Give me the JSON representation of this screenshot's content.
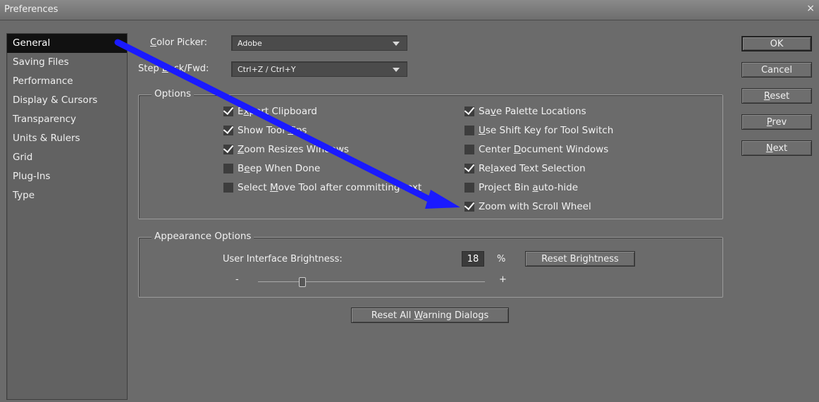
{
  "window": {
    "title": "Preferences",
    "close_glyph": "×"
  },
  "sidebar": {
    "items": [
      {
        "label": "General",
        "active": true
      },
      {
        "label": "Saving Files"
      },
      {
        "label": "Performance"
      },
      {
        "label": "Display & Cursors"
      },
      {
        "label": "Transparency"
      },
      {
        "label": "Units & Rulers"
      },
      {
        "label": "Grid"
      },
      {
        "label": "Plug-Ins"
      },
      {
        "label": "Type"
      }
    ]
  },
  "general": {
    "color_picker": {
      "label_underlined": "C",
      "label_rest": "olor Picker:",
      "value": "Adobe"
    },
    "step": {
      "label_prefix": "Step ",
      "label_underlined": "B",
      "label_rest": "ack/Fwd:",
      "value": "Ctrl+Z / Ctrl+Y"
    },
    "options_legend": "Options",
    "options_left": [
      {
        "pre": "E",
        "u": "x",
        "post": "port Clipboard",
        "checked": true
      },
      {
        "pre": "Show Tool ",
        "u": "T",
        "post": "ips",
        "checked": true
      },
      {
        "pre": "",
        "u": "Z",
        "post": "oom Resizes Windows",
        "checked": true
      },
      {
        "pre": "B",
        "u": "e",
        "post": "ep When Done",
        "checked": false
      },
      {
        "pre": "Select ",
        "u": "M",
        "post": "ove Tool after committing text",
        "checked": false
      }
    ],
    "options_right": [
      {
        "pre": "Sa",
        "u": "v",
        "post": "e Palette Locations",
        "checked": true
      },
      {
        "pre": "",
        "u": "U",
        "post": "se Shift Key for Tool Switch",
        "checked": false
      },
      {
        "pre": "Center ",
        "u": "D",
        "post": "ocument Windows",
        "checked": false
      },
      {
        "pre": "Re",
        "u": "l",
        "post": "axed Text Selection",
        "checked": true
      },
      {
        "pre": "Project Bin ",
        "u": "a",
        "post": "uto-hide",
        "checked": false
      },
      {
        "pre": "",
        "u": "",
        "post": "Zoom with Scroll Wheel",
        "checked": true
      }
    ],
    "appearance_legend": "Appearance Options",
    "brightness_label": "User Interface Brightness:",
    "brightness_value": "18",
    "brightness_unit": "%",
    "reset_brightness": "Reset Brightness",
    "slider_minus": "-",
    "slider_plus": "+",
    "brightness_fraction": 0.18,
    "reset_warnings": {
      "pre": "Reset All ",
      "u": "W",
      "post": "arning Dialogs"
    }
  },
  "buttons": {
    "ok": {
      "pre": "OK",
      "u": "",
      "post": ""
    },
    "cancel": {
      "pre": "Cancel",
      "u": "",
      "post": ""
    },
    "reset": {
      "pre": "",
      "u": "R",
      "post": "eset"
    },
    "prev": {
      "pre": "",
      "u": "P",
      "post": "rev"
    },
    "next": {
      "pre": "",
      "u": "N",
      "post": "ext"
    }
  },
  "colors": {
    "annotation_arrow": "#1a1aff",
    "panel_bg": "#6b6b6b",
    "selected": "#111111"
  }
}
